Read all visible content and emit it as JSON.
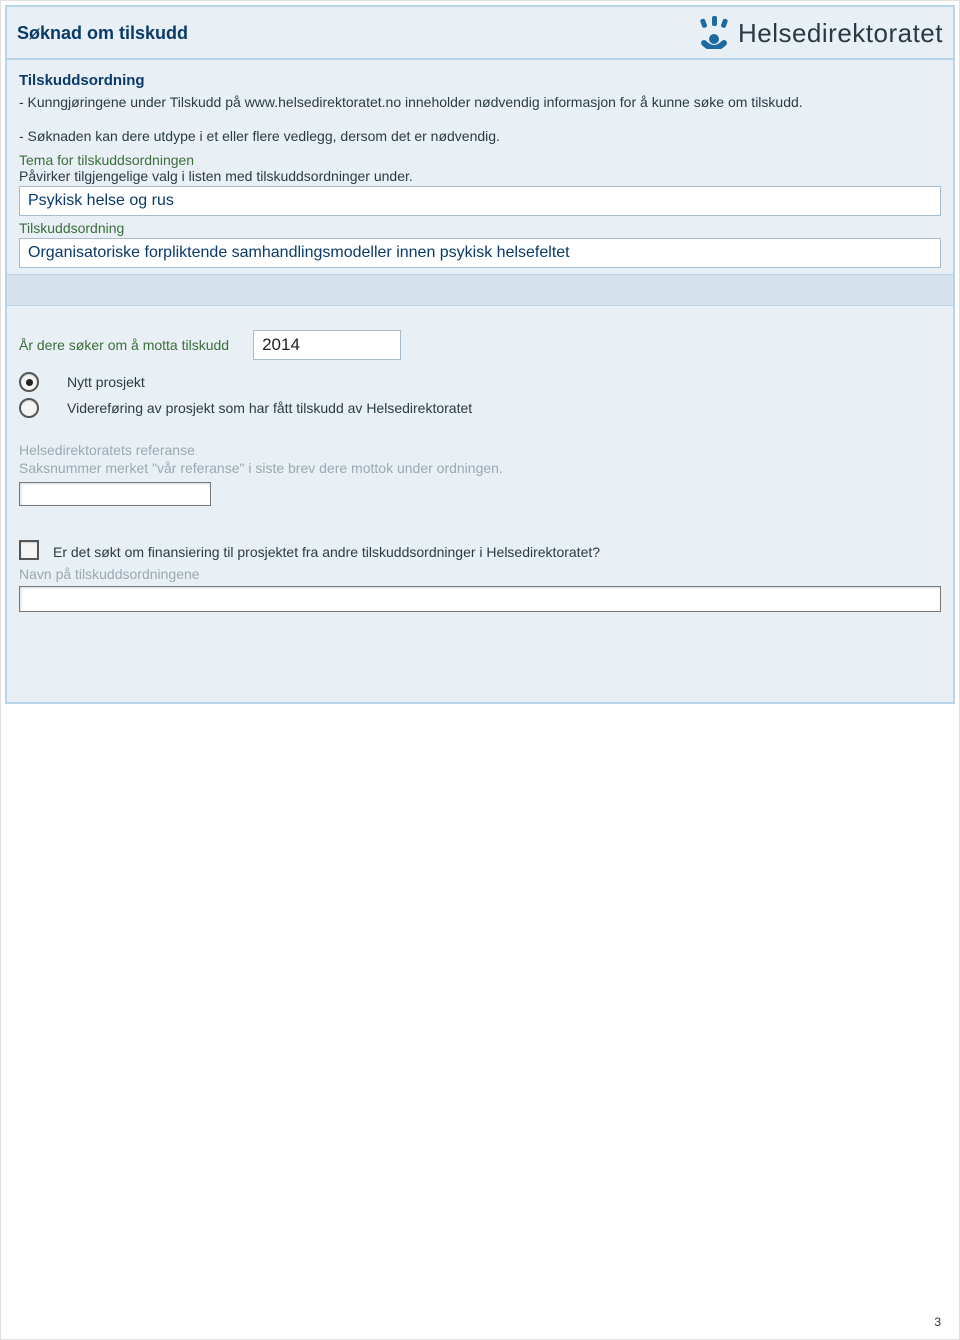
{
  "header": {
    "title": "Søknad om tilskudd",
    "brand": "Helsedirektoratet"
  },
  "section": {
    "heading": "Tilskuddsordning",
    "info1": "- Kunngjøringene under Tilskudd på www.helsedirektoratet.no inneholder nødvendig informasjon for å kunne søke om tilskudd.",
    "info2": "- Søknaden kan dere utdype i et eller flere vedlegg, dersom det er nødvendig.",
    "tema_label": "Tema for tilskuddsordningen",
    "tema_help": "Påvirker tilgjengelige valg i listen med tilskuddsordninger under.",
    "tema_value": "Psykisk helse og rus",
    "ordning_label": "Tilskuddsordning",
    "ordning_value": "Organisatoriske forpliktende samhandlingsmodeller innen psykisk helsefeltet"
  },
  "year": {
    "label": "År dere søker om å motta tilskudd",
    "value": "2014"
  },
  "project_type": {
    "option_new": "Nytt prosjekt",
    "option_cont": "Videreføring av prosjekt som har fått tilskudd av Helsedirektoratet",
    "selected": "new"
  },
  "reference": {
    "label": "Helsedirektoratets referanse",
    "help": "Saksnummer merket \"vår referanse\" i siste brev dere mottok under ordningen."
  },
  "other_funding": {
    "question": "Er det søkt om finansiering til prosjektet fra andre tilskuddsordninger i Helsedirektoratet?",
    "names_label": "Navn på tilskuddsordningene"
  },
  "page_number": "3"
}
